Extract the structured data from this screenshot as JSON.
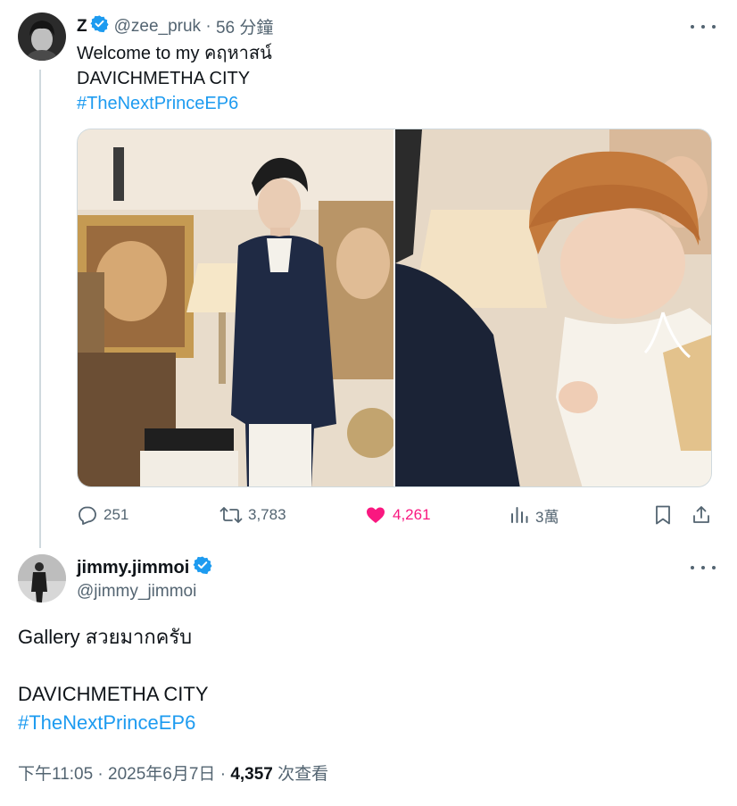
{
  "parent_tweet": {
    "display_name": "Z",
    "handle": "@zee_pruk",
    "separator": " · ",
    "time_ago": "56 分鐘",
    "text_line1": "Welcome to my คฤหาสน์",
    "text_line2": "DAVICHMETHA CITY",
    "hashtag": "#TheNextPrinceEP6",
    "stats": {
      "replies": "251",
      "reposts": "3,783",
      "likes": "4,261",
      "views": "3萬"
    },
    "liked": true
  },
  "reply_tweet": {
    "display_name": "jimmy.jimmoi",
    "handle": "@jimmy_jimmoi",
    "text_line1": "Gallery สวยมากครับ",
    "text_line2": "DAVICHMETHA CITY",
    "hashtag": "#TheNextPrinceEP6",
    "time": "下午11:05",
    "separator1": " · ",
    "date": "2025年6月7日",
    "separator2": " · ",
    "views": "4,357",
    "views_label": " 次查看"
  },
  "colors": {
    "accent": "#1d9bf0",
    "like": "#f91880",
    "muted": "#536471",
    "text": "#0f1419",
    "divider": "#cfd9de"
  },
  "icons": [
    "verified-badge-icon",
    "more-icon",
    "reply-icon",
    "repost-icon",
    "heart-icon",
    "views-icon",
    "bookmark-icon",
    "share-icon"
  ]
}
